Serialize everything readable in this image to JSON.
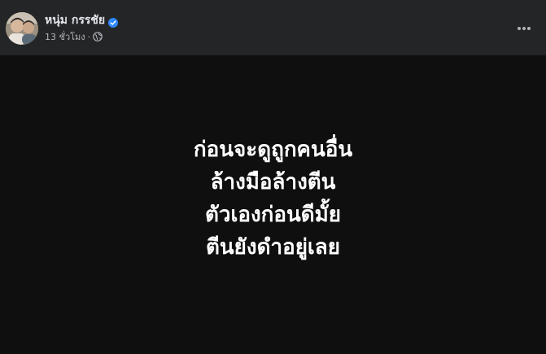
{
  "author": {
    "name": "หนุ่ม กรรชัย",
    "verified_icon": "verified-badge-icon",
    "avatar_icon": "profile-photo"
  },
  "meta": {
    "time": "13 ชั่วโมง",
    "separator": "·",
    "audience_icon": "globe-icon"
  },
  "actions": {
    "more_icon": "more-options-icon"
  },
  "post": {
    "lines": [
      "ก่อนจะดูถูกคนอื่น",
      "ล้างมือล้างตีน",
      "ตัวเองก่อนดีมั้ย",
      "ตีนยังดำอยู่เลย"
    ]
  },
  "colors": {
    "header_bg": "#242526",
    "post_bg": "#0f0f0f",
    "text_primary": "#e4e6eb",
    "text_secondary": "#b0b3b8",
    "verified": "#2d88ff"
  }
}
